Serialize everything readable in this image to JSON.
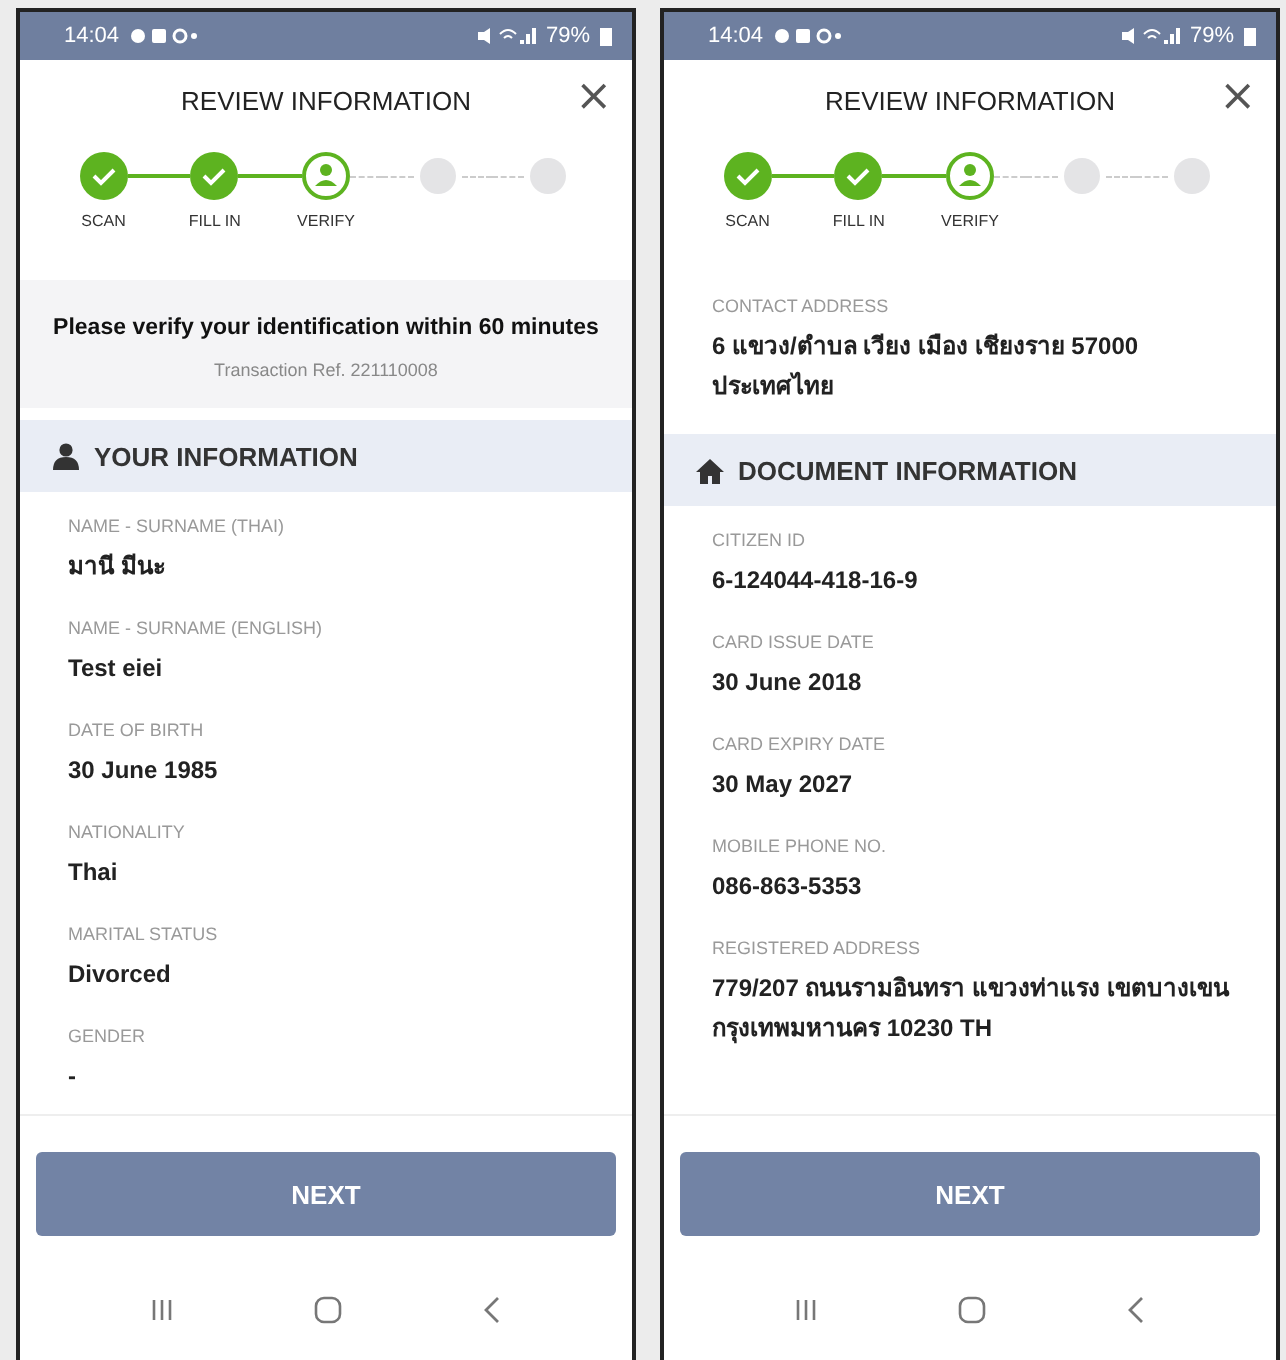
{
  "screens": [
    {
      "status_bar": {
        "time": "14:04",
        "battery": "79%"
      },
      "title": "REVIEW INFORMATION",
      "close": "×",
      "steps": [
        {
          "label": "SCAN",
          "done": true,
          "selected": false
        },
        {
          "label": "FILL IN",
          "done": true,
          "selected": false
        },
        {
          "label": "VERIFY",
          "done": false,
          "selected": true
        },
        {
          "done": false,
          "selected": false
        },
        {
          "done": false,
          "selected": false
        }
      ],
      "blocks": [
        {
          "kind": "notice",
          "text": "Please verify your identification within 60 minutes",
          "ref": "Transaction Ref. 221110008"
        },
        {
          "kind": "personal-section",
          "title": "YOUR INFORMATION"
        },
        {
          "kind": "field",
          "label": "NAME - SURNAME (THAI)",
          "value": "มานี มีนะ"
        },
        {
          "kind": "field",
          "label": "NAME - SURNAME (ENGLISH)",
          "value": "Test eiei"
        },
        {
          "kind": "field",
          "label": "DATE OF BIRTH",
          "value": "30 June 1985"
        },
        {
          "kind": "field",
          "label": "NATIONALITY",
          "value": "Thai"
        },
        {
          "kind": "field",
          "label": "MARITAL STATUS",
          "value": "Divorced"
        },
        {
          "kind": "field",
          "label": "GENDER",
          "value": "-"
        }
      ],
      "button": "NEXT"
    },
    {
      "status_bar": {
        "time": "14:04",
        "battery": "79%"
      },
      "title": "REVIEW INFORMATION",
      "close": "×",
      "steps": [
        {
          "label": "SCAN",
          "done": true,
          "selected": false
        },
        {
          "label": "FILL IN",
          "done": true,
          "selected": false
        },
        {
          "label": "VERIFY",
          "done": false,
          "selected": true
        },
        {
          "done": false,
          "selected": false
        },
        {
          "done": false,
          "selected": false
        }
      ],
      "blocks": [
        {
          "kind": "field",
          "label": "CONTACT ADDRESS",
          "value": "6 แขวง/ตำบล เวียง เมือง เชียงราย 57000 ประเทศไทย"
        },
        {
          "kind": "document-section",
          "title": "DOCUMENT INFORMATION"
        },
        {
          "kind": "field",
          "label": "CITIZEN ID",
          "value": "6-124044-418-16-9"
        },
        {
          "kind": "field",
          "label": "CARD ISSUE DATE",
          "value": "30 June 2018"
        },
        {
          "kind": "field",
          "label": "CARD EXPIRY DATE",
          "value": "30 May 2027"
        },
        {
          "kind": "field",
          "label": "MOBILE PHONE NO.",
          "value": "086-863-5353"
        },
        {
          "kind": "field",
          "label": "REGISTERED ADDRESS",
          "value": "779/207 ถนนรามอินทรา แขวงท่าแรง เขตบางเขน กรุงเทพมหานคร 10230 TH"
        }
      ],
      "button": "NEXT"
    }
  ]
}
